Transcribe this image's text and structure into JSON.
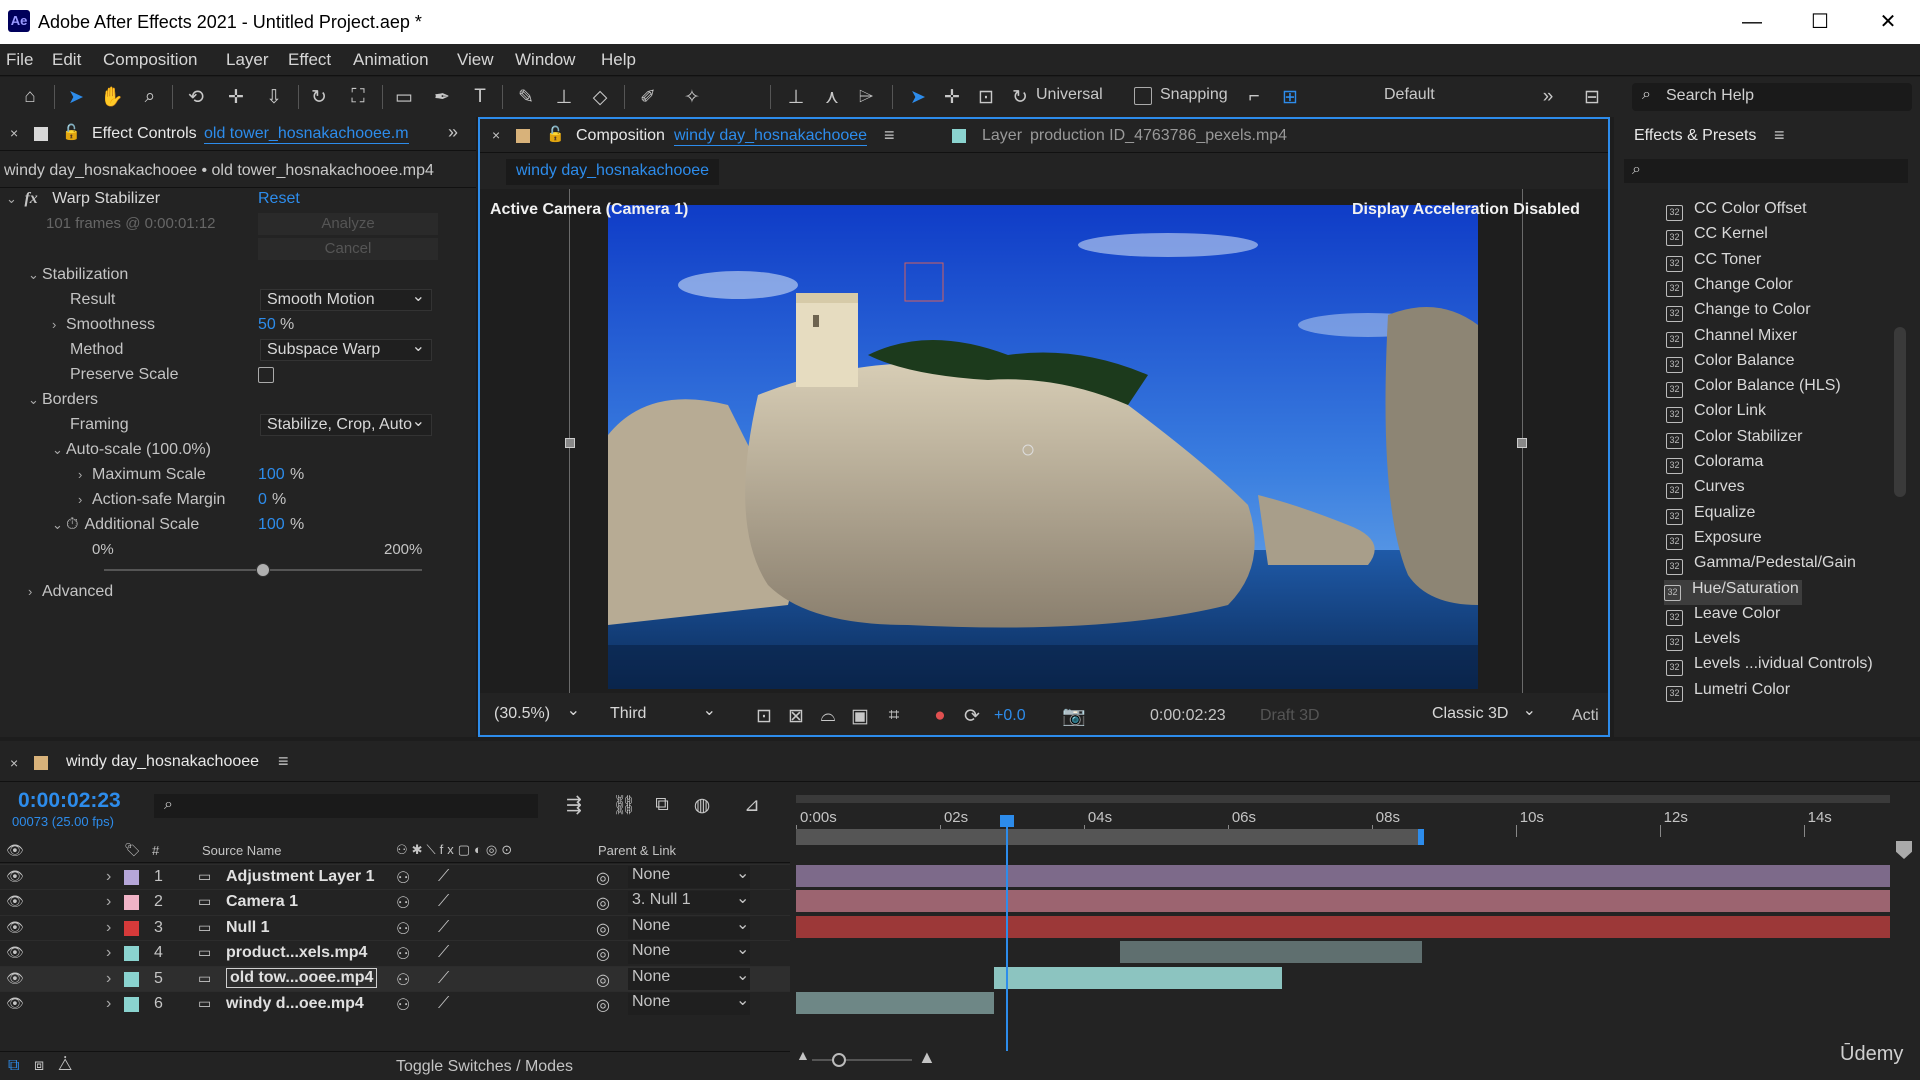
{
  "window": {
    "title": "Adobe After Effects 2021 - Untitled Project.aep *",
    "logo": "Ae",
    "minimize": "—",
    "maximize": "☐",
    "close": "✕"
  },
  "menu": [
    "File",
    "Edit",
    "Composition",
    "Layer",
    "Effect",
    "Animation",
    "View",
    "Window",
    "Help"
  ],
  "toolbar": {
    "universal_label": "Universal",
    "snapping_label": "Snapping",
    "workspace": "Default",
    "search_help": "Search Help"
  },
  "effect_controls": {
    "tab_label": "Effect Controls",
    "tab_layer": "old tower_hosnakachooee.m",
    "breadcrumb": "windy day_hosnakachooee • old tower_hosnakachooee.mp4",
    "effect_name": "Warp Stabilizer",
    "reset": "Reset",
    "fx": "fx",
    "frames_info": "101 frames @ 0:00:01:12",
    "analyze": "Analyze",
    "cancel": "Cancel",
    "stabilization": "Stabilization",
    "result_label": "Result",
    "result_value": "Smooth Motion",
    "smoothness_label": "Smoothness",
    "smoothness_value": "50",
    "smoothness_unit": "%",
    "method_label": "Method",
    "method_value": "Subspace Warp",
    "preserve_scale_label": "Preserve Scale",
    "borders": "Borders",
    "framing_label": "Framing",
    "framing_value": "Stabilize, Crop, Auto",
    "auto_scale": "Auto-scale (100.0%)",
    "max_scale_label": "Maximum Scale",
    "max_scale_value": "100",
    "max_scale_unit": "%",
    "action_safe_label": "Action-safe Margin",
    "action_safe_value": "0",
    "action_safe_unit": "%",
    "additional_scale_label": "Additional Scale",
    "additional_scale_value": "100",
    "additional_scale_unit": "%",
    "slider_min": "0%",
    "slider_max": "200%",
    "slider_fraction": 0.5,
    "advanced": "Advanced"
  },
  "composition": {
    "tab_label": "Composition",
    "tab_name": "windy day_hosnakachooee",
    "layer_tab_label": "Layer",
    "layer_tab_name": "production ID_4763786_pexels.mp4",
    "sub_tab": "windy day_hosnakachooee",
    "camera_label": "Active Camera (Camera 1)",
    "accel_label": "Display Acceleration Disabled",
    "zoom": "(30.5%)",
    "resolution": "Third",
    "exposure": "+0.0",
    "timecode": "0:00:02:23",
    "draft3d": "Draft 3D",
    "renderer": "Classic 3D",
    "view": "Acti"
  },
  "effects_presets": {
    "title": "Effects & Presets",
    "search_icon": "⌕",
    "items": [
      {
        "label": "CC Color Offset"
      },
      {
        "label": "CC Kernel"
      },
      {
        "label": "CC Toner"
      },
      {
        "label": "Change Color"
      },
      {
        "label": "Change to Color"
      },
      {
        "label": "Channel Mixer"
      },
      {
        "label": "Color Balance"
      },
      {
        "label": "Color Balance (HLS)"
      },
      {
        "label": "Color Link"
      },
      {
        "label": "Color Stabilizer"
      },
      {
        "label": "Colorama"
      },
      {
        "label": "Curves"
      },
      {
        "label": "Equalize"
      },
      {
        "label": "Exposure"
      },
      {
        "label": "Gamma/Pedestal/Gain"
      },
      {
        "label": "Hue/Saturation"
      },
      {
        "label": "Leave Color"
      },
      {
        "label": "Levels"
      },
      {
        "label": "Levels ...ividual Controls)"
      },
      {
        "label": "Lumetri Color"
      }
    ],
    "selected": "Hue/Saturation"
  },
  "timeline": {
    "comp_name": "windy day_hosnakachooee",
    "timecode": "0:00:02:23",
    "frame_info": "00073 (25.00 fps)",
    "col_hash": "#",
    "col_source": "Source Name",
    "col_parent": "Parent & Link",
    "ruler": [
      "0:00s",
      "02s",
      "04s",
      "06s",
      "08s",
      "10s",
      "12s",
      "14s"
    ],
    "ruler_max_seconds": 15.2,
    "playhead_seconds": 2.92,
    "work_area_end_seconds": 8.72,
    "toggle_label": "Toggle Switches / Modes",
    "watermark": "Ūdemy",
    "layers": [
      {
        "num": "1",
        "name": "Adjustment Layer 1",
        "label_color": "#b5a6d8",
        "parent": "None",
        "start": 0,
        "end": 15.2,
        "color": "#7d6a8a",
        "selected": false
      },
      {
        "num": "2",
        "name": "Camera 1",
        "label_color": "#f0b3c6",
        "parent": "3. Null 1",
        "start": 0,
        "end": 15.2,
        "color": "#9c6470",
        "selected": false
      },
      {
        "num": "3",
        "name": "Null 1",
        "label_color": "#d53a3a",
        "parent": "None",
        "start": 0,
        "end": 15.2,
        "color": "#9c3838",
        "selected": false
      },
      {
        "num": "4",
        "name": "product...xels.mp4",
        "label_color": "#8ad3cf",
        "parent": "None",
        "start": 4.5,
        "end": 8.7,
        "color": "#5f6f6f",
        "selected": false
      },
      {
        "num": "5",
        "name": "old tow...ooee.mp4",
        "label_color": "#8ad3cf",
        "parent": "None",
        "start": 2.75,
        "end": 6.75,
        "color": "#8cc4c0",
        "selected": true
      },
      {
        "num": "6",
        "name": "windy d...oee.mp4",
        "label_color": "#8ad3cf",
        "parent": "None",
        "start": 0,
        "end": 2.75,
        "color": "#6e8786",
        "selected": false
      }
    ]
  }
}
